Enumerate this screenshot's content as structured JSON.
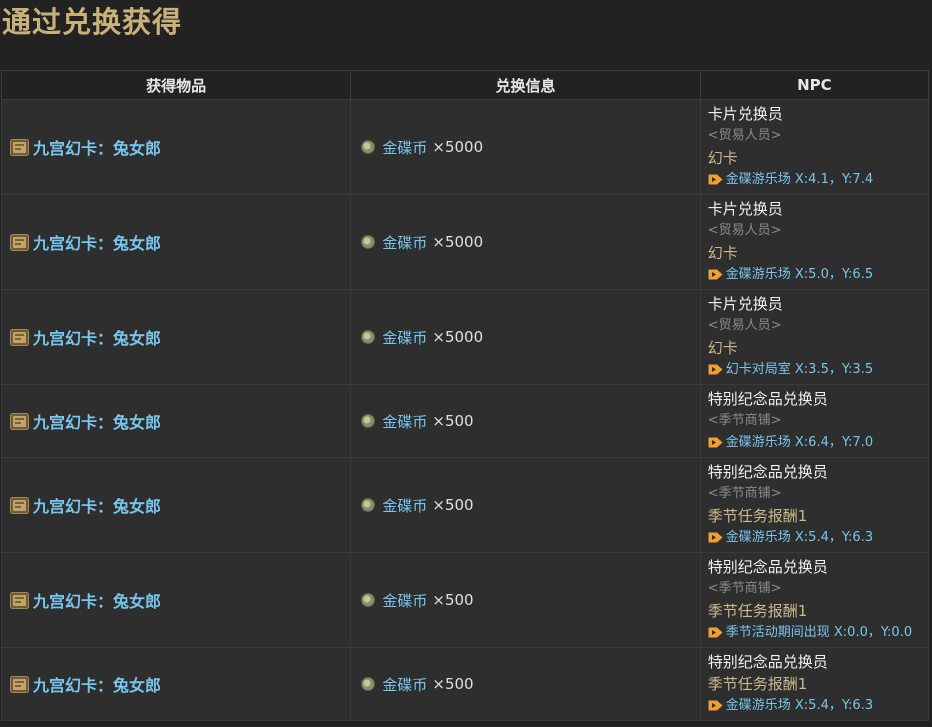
{
  "page": {
    "title": "通过兑换获得"
  },
  "table": {
    "headers": [
      "获得物品",
      "兑换信息",
      "NPC"
    ],
    "rows": [
      {
        "item": "九宫幻卡：兔女郎",
        "currency": "金碟币",
        "amount": "×5000",
        "npc_name": "卡片兑换员",
        "npc_role": "<贸易人员>",
        "npc_shop": "幻卡",
        "npc_location": "金碟游乐场 X:4.1，Y:7.4"
      },
      {
        "item": "九宫幻卡：兔女郎",
        "currency": "金碟币",
        "amount": "×5000",
        "npc_name": "卡片兑换员",
        "npc_role": "<贸易人员>",
        "npc_shop": "幻卡",
        "npc_location": "金碟游乐场 X:5.0，Y:6.5"
      },
      {
        "item": "九宫幻卡：兔女郎",
        "currency": "金碟币",
        "amount": "×5000",
        "npc_name": "卡片兑换员",
        "npc_role": "<贸易人员>",
        "npc_shop": "幻卡",
        "npc_location": "幻卡对局室 X:3.5，Y:3.5"
      },
      {
        "item": "九宫幻卡：兔女郎",
        "currency": "金碟币",
        "amount": "×500",
        "npc_name": "特别纪念品兑换员",
        "npc_role": "<季节商铺>",
        "npc_shop": "",
        "npc_location": "金碟游乐场 X:6.4，Y:7.0"
      },
      {
        "item": "九宫幻卡：兔女郎",
        "currency": "金碟币",
        "amount": "×500",
        "npc_name": "特别纪念品兑换员",
        "npc_role": "<季节商铺>",
        "npc_shop": "季节任务报酬1",
        "npc_location": "金碟游乐场 X:5.4，Y:6.3"
      },
      {
        "item": "九宫幻卡：兔女郎",
        "currency": "金碟币",
        "amount": "×500",
        "npc_name": "特别纪念品兑换员",
        "npc_role": "<季节商铺>",
        "npc_shop": "季节任务报酬1",
        "npc_location": "季节活动期间出现 X:0.0，Y:0.0"
      },
      {
        "item": "九宫幻卡：兔女郎",
        "currency": "金碟币",
        "amount": "×500",
        "npc_name": "特别纪念品兑换员",
        "npc_role": "",
        "npc_shop": "季节任务报酬1",
        "npc_location": "金碟游乐场 X:5.4，Y:6.3"
      }
    ]
  },
  "icons": {
    "item": "card-item-icon",
    "currency": "gold-coin-icon",
    "location": "map-marker-tag-icon"
  },
  "colors": {
    "title": "#c8b27a",
    "link": "#78c6ee",
    "muted": "#8a8a8a",
    "shop": "#c9b98c",
    "location_tag": "#f0a030"
  }
}
